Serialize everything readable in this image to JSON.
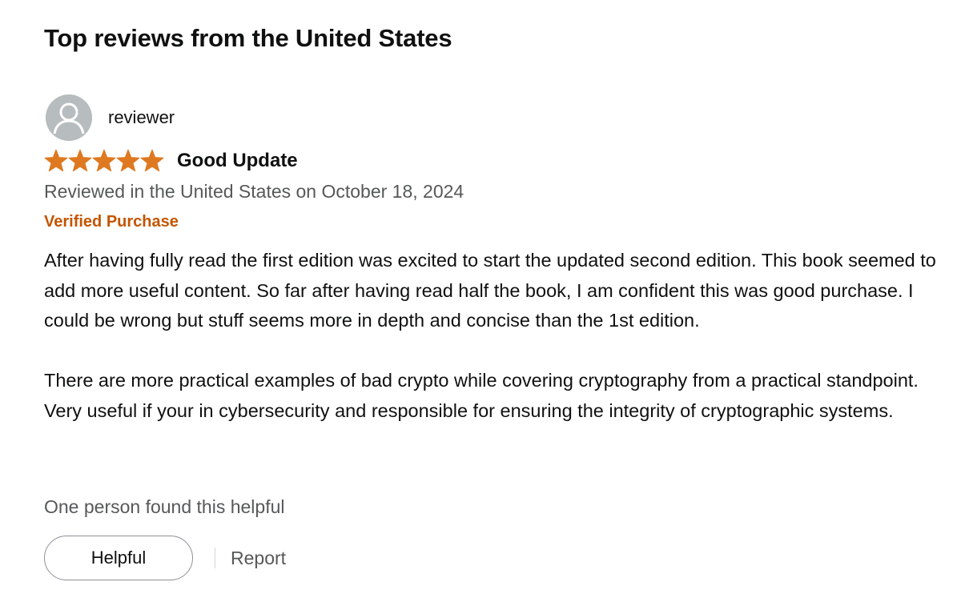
{
  "section": {
    "heading": "Top reviews from the United States"
  },
  "review": {
    "reviewer_name": "reviewer",
    "avatar_icon": "user-silhouette-icon",
    "rating": 5,
    "rating_max": 5,
    "star_color": "#de7921",
    "title": "Good Update",
    "date_line": "Reviewed in the United States on October 18, 2024",
    "verified_label": "Verified Purchase",
    "verified_color": "#c45500",
    "body": [
      "After having fully read the first edition was excited to start the updated second edition. This book seemed to add more useful content. So far after having read half the book, I am confident this was good purchase. I could be wrong but stuff seems more in depth and concise than the 1st edition.",
      "There are more practical examples of bad crypto while covering cryptography from a practical standpoint. Very useful if your in cybersecurity and responsible for ensuring the integrity of cryptographic systems."
    ],
    "helpful_count_text": "One person found this helpful",
    "helpful_button_label": "Helpful",
    "report_label": "Report"
  }
}
